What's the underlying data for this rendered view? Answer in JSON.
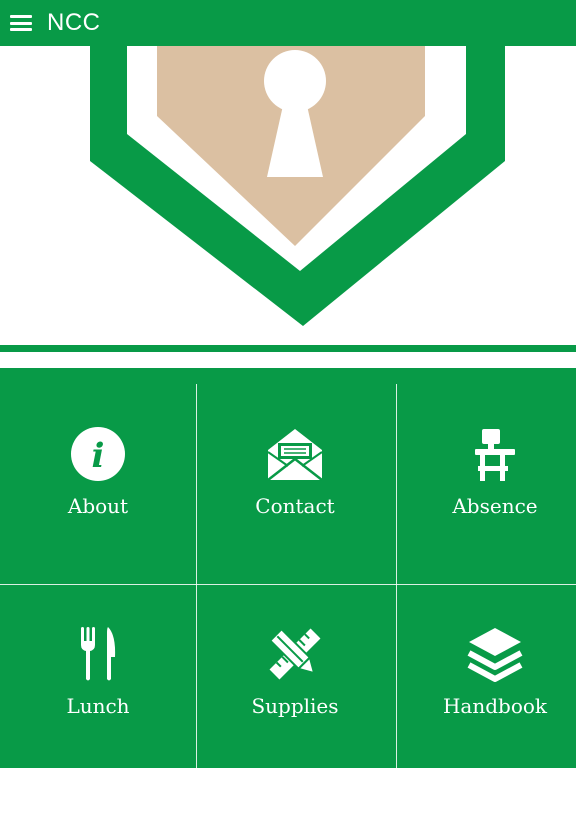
{
  "appbar": {
    "title": "NCC"
  },
  "colors": {
    "brand_green": "#089a47",
    "shield_tan": "#dbc0a2",
    "white": "#ffffff"
  },
  "tiles": [
    {
      "label": "About",
      "icon": "info-icon"
    },
    {
      "label": "Contact",
      "icon": "envelope-icon"
    },
    {
      "label": "Absence",
      "icon": "school-desk-icon"
    },
    {
      "label": "Lunch",
      "icon": "fork-knife-icon"
    },
    {
      "label": "Supplies",
      "icon": "pencil-ruler-icon"
    },
    {
      "label": "Handbook",
      "icon": "layers-icon"
    }
  ]
}
